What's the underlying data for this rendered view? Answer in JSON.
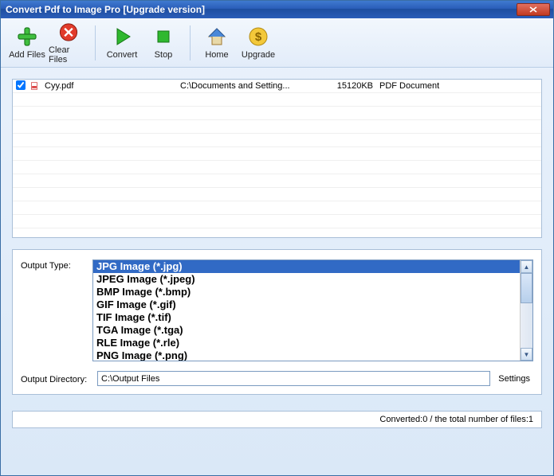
{
  "window": {
    "title": "Convert Pdf to Image Pro [Upgrade version]"
  },
  "toolbar": {
    "add_files": "Add Files",
    "clear_files": "Clear Files",
    "convert": "Convert",
    "stop": "Stop",
    "home": "Home",
    "upgrade": "Upgrade"
  },
  "files": [
    {
      "checked": true,
      "name": "Cyy.pdf",
      "path": "C:\\Documents and Setting...",
      "size": "15120KB",
      "type": "PDF Document"
    }
  ],
  "options": {
    "output_type_label": "Output Type:",
    "types": [
      "JPG Image (*.jpg)",
      "JPEG Image (*.jpeg)",
      "BMP Image (*.bmp)",
      "GIF Image (*.gif)",
      "TIF Image (*.tif)",
      "TGA Image (*.tga)",
      "RLE Image (*.rle)",
      "PNG Image (*.png)"
    ],
    "selected_index": 0,
    "output_dir_label": "Output Directory:",
    "output_dir": "C:\\Output Files",
    "settings_label": "Settings"
  },
  "status": {
    "text": "Converted:0  /  the total number of files:1"
  }
}
